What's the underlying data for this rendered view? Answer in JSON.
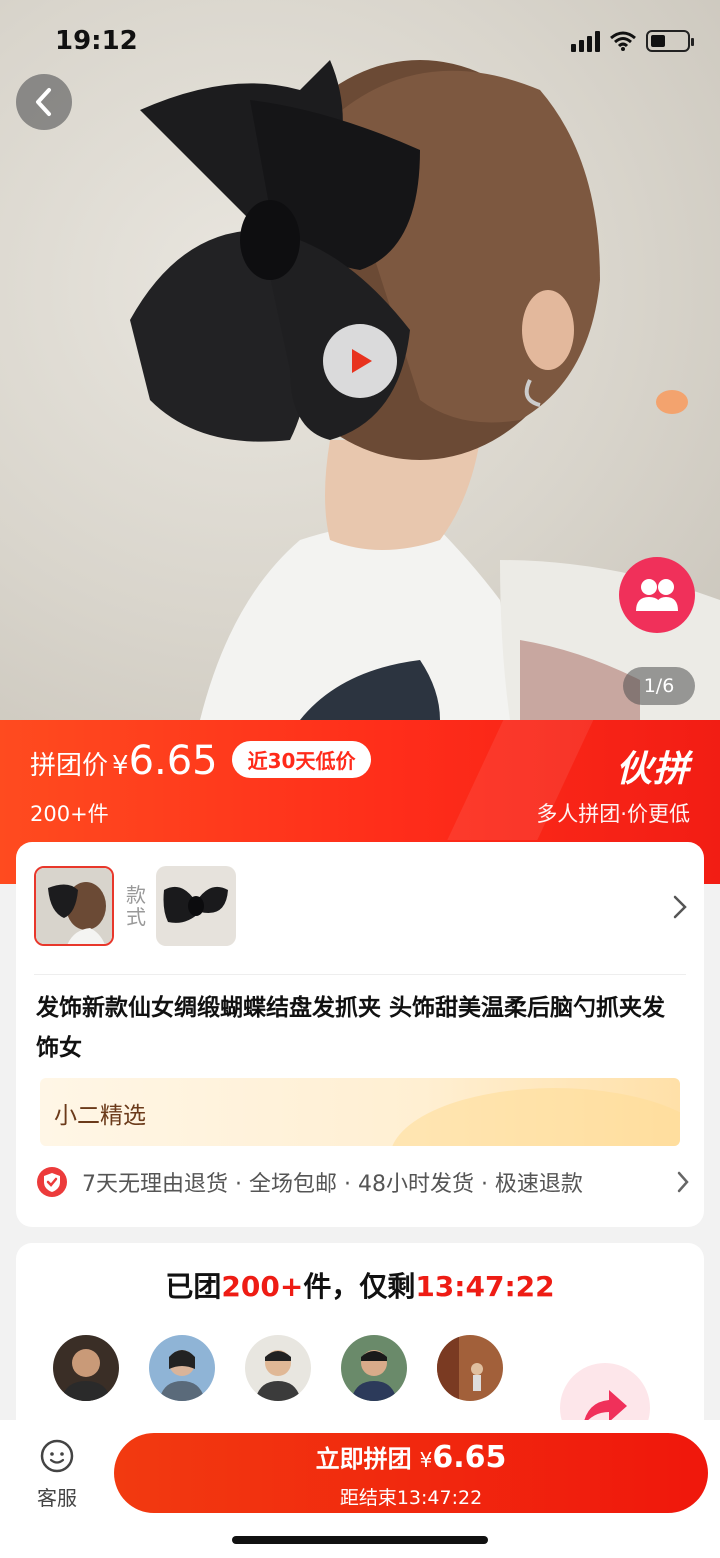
{
  "status": {
    "time": "19:12"
  },
  "hero": {
    "image_counter": "1/6"
  },
  "price_banner": {
    "label": "拼团价",
    "currency": "¥",
    "price": "6.65",
    "low_badge": "近30天低价",
    "sold": "200+件",
    "brand": "伙拼",
    "tagline": "多人拼团·价更低"
  },
  "variants": {
    "label": "款式"
  },
  "product": {
    "title": "发饰新款仙女绸缎蝴蝶结盘发抓夹 头饰甜美温柔后脑勺抓夹发饰女",
    "pick_label": "小二精选",
    "guarantees": "7天无理由退货 · 全场包邮 · 48小时发货 · 极速退款"
  },
  "group": {
    "prefix": "已团",
    "count": "200+",
    "mid": "件，仅剩",
    "countdown": "13:47:22"
  },
  "bottom": {
    "service_label": "客服",
    "buy_label": "立即拼团",
    "buy_currency": "¥",
    "buy_price": "6.65",
    "ends_label": "距结束13:47:22"
  },
  "colors": {
    "accent": "#ee1c14",
    "fab": "#f0305a"
  }
}
